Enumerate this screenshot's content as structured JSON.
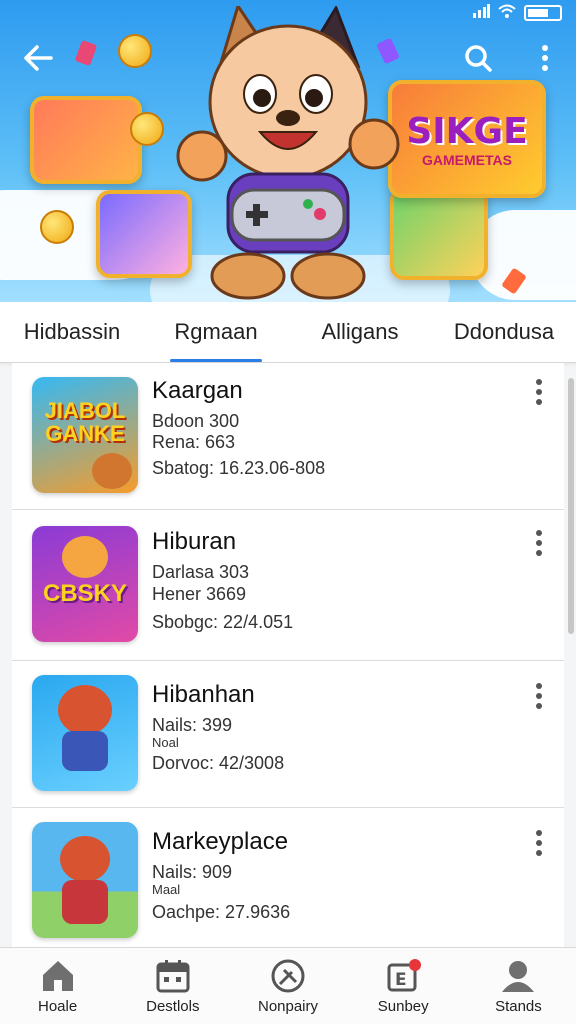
{
  "header": {
    "hero_logo_text": "SIKGE",
    "hero_logo_subtext": "GAMEMETAS"
  },
  "tabs": [
    {
      "label": "Hidbassin",
      "active": false
    },
    {
      "label": "Rgmaan",
      "active": true
    },
    {
      "label": "Alligans",
      "active": false
    },
    {
      "label": "Ddondusa",
      "active": false
    }
  ],
  "list": [
    {
      "title": "Kaargan",
      "line1": "Bdoon 300",
      "line2": "Rena: 663",
      "line3": "Sbatog: 16.23.06-808",
      "thumb_text": "JIABOL GANKE",
      "thumb_colors": [
        "#35b9f4",
        "#f79c2a"
      ]
    },
    {
      "title": "Hiburan",
      "line1": "Darlasa 303",
      "line2": "Hener 3669",
      "line3": "Sbobgc: 22/4.051",
      "thumb_text": "CBSKY",
      "thumb_colors": [
        "#8a3bd6",
        "#e24aa6"
      ]
    },
    {
      "title": "Hibanhan",
      "line1": "Nails: 399",
      "line2": "Noal",
      "line3": "Dorvoc: 42/3008",
      "thumb_text": "",
      "thumb_colors": [
        "#2aa8ef",
        "#6ad0ff"
      ]
    },
    {
      "title": "Markeyplace",
      "line1": "Nails: 909",
      "line2": "Maal",
      "line3": "Oachpe: 27.9636",
      "thumb_text": "",
      "thumb_colors": [
        "#58b7ee",
        "#8fd069"
      ]
    }
  ],
  "bottom_nav": [
    {
      "label": "Hoale",
      "icon": "home-icon"
    },
    {
      "label": "Destlols",
      "icon": "calendar-icon"
    },
    {
      "label": "Nonpairy",
      "icon": "compass-icon"
    },
    {
      "label": "Sunbey",
      "icon": "notification-icon"
    },
    {
      "label": "Stands",
      "icon": "profile-icon"
    }
  ],
  "colors": {
    "accent": "#2b7de9",
    "hero_sky": "#2e9bf0"
  }
}
